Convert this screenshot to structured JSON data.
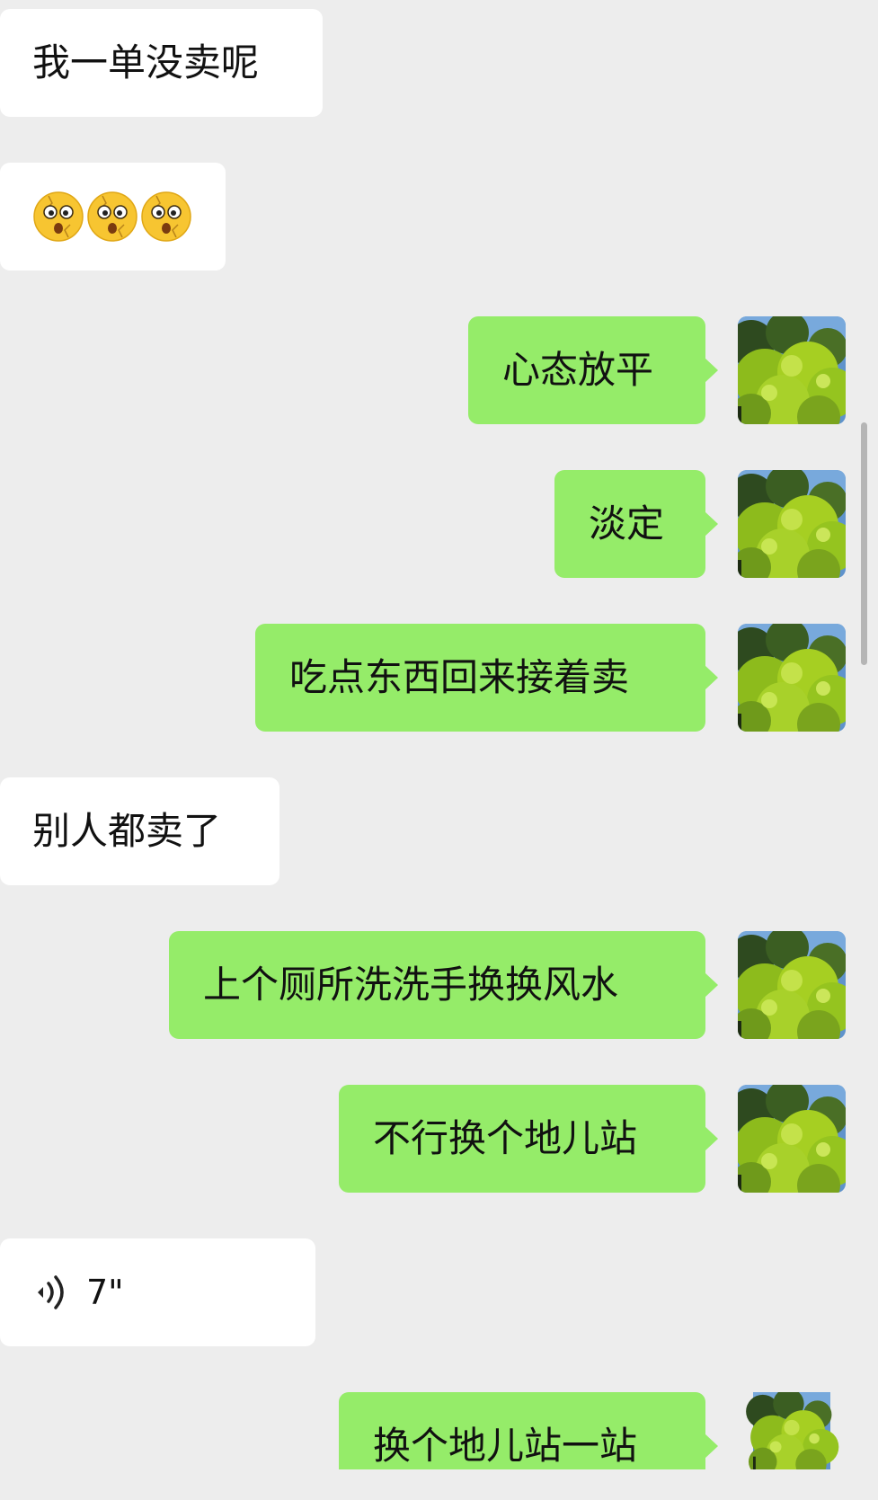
{
  "messages": [
    {
      "side": "in",
      "type": "text",
      "text": "我一单没卖呢"
    },
    {
      "side": "in",
      "type": "emoji",
      "emoji": "dizzy-face-emoji",
      "count": 3
    },
    {
      "side": "out",
      "type": "text",
      "text": "心态放平"
    },
    {
      "side": "out",
      "type": "text",
      "text": "淡定"
    },
    {
      "side": "out",
      "type": "text",
      "text": "吃点东西回来接着卖"
    },
    {
      "side": "in",
      "type": "text",
      "text": "别人都卖了"
    },
    {
      "side": "out",
      "type": "text",
      "text": "上个厕所洗洗手换换风水"
    },
    {
      "side": "out",
      "type": "text",
      "text": "不行换个地儿站"
    },
    {
      "side": "in",
      "type": "voice",
      "duration": "7\""
    },
    {
      "side": "out",
      "type": "text",
      "text": "换个地儿站一站"
    }
  ],
  "colors": {
    "background": "#ededed",
    "incoming_bubble": "#ffffff",
    "outgoing_bubble": "#95ec69",
    "text": "#111111"
  },
  "avatar": {
    "icon": "green-tree-avatar"
  }
}
